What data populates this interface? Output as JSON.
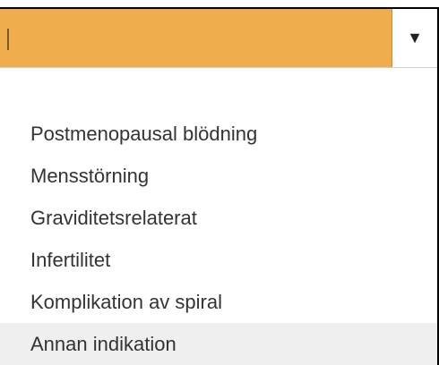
{
  "dropdown": {
    "input_value": "",
    "arrow_glyph": "▼",
    "input_color": "#f0ad4e",
    "options": [
      "Postmenopausal blödning",
      "Mensstörning",
      "Graviditetsrelaterat",
      "Infertilitet",
      "Komplikation av spiral",
      "Annan indikation"
    ],
    "highlighted_option": "Annan indikation"
  }
}
